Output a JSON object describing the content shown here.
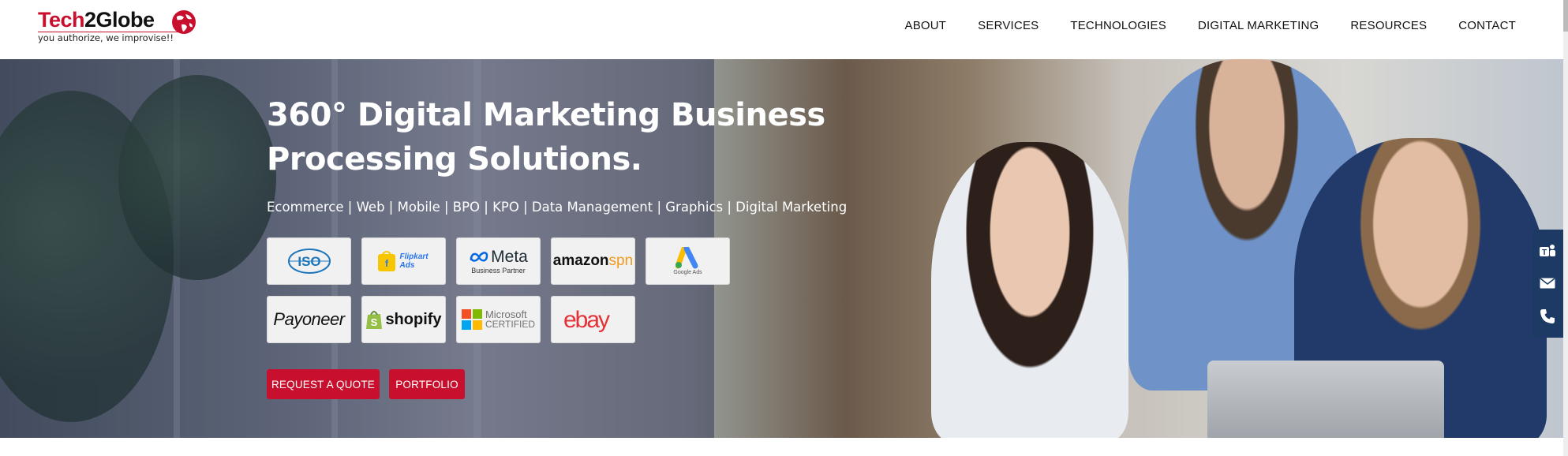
{
  "brand": {
    "name_part1": "Tech",
    "name_part2": "2Globe",
    "tagline": "you authorize, we improvise!!",
    "colors": {
      "primary": "#c8102e",
      "sidebar": "#1c3a64"
    }
  },
  "nav": {
    "items": [
      "ABOUT",
      "SERVICES",
      "TECHNOLOGIES",
      "DIGITAL MARKETING",
      "RESOURCES",
      "CONTACT"
    ]
  },
  "hero": {
    "title_line1": "360° Digital Marketing Business",
    "title_line2": "Processing Solutions.",
    "subtitle": "Ecommerce | Web | Mobile | BPO | KPO | Data Management | Graphics | Digital Marketing",
    "badges": [
      {
        "label": "ISO",
        "icon": "iso-logo"
      },
      {
        "label": "Flipkart Ads",
        "icon": "flipkart-ads-logo"
      },
      {
        "label": "Meta",
        "sub": "Business Partner",
        "icon": "meta-logo"
      },
      {
        "label": "amazon",
        "sub": "spn",
        "icon": "amazon-spn-logo"
      },
      {
        "label": "Google Ads",
        "icon": "google-ads-logo"
      },
      {
        "label": "Payoneer",
        "icon": "payoneer-logo"
      },
      {
        "label": "shopify",
        "icon": "shopify-logo"
      },
      {
        "label": "Microsoft",
        "sub": "CERTIFIED",
        "icon": "microsoft-logo"
      },
      {
        "label": "ebay",
        "icon": "ebay-logo"
      }
    ],
    "buttons": {
      "quote": "REQUEST A QUOTE",
      "portfolio": "PORTFOLIO"
    }
  },
  "side_contact": {
    "icons": [
      "teams-icon",
      "mail-icon",
      "phone-icon"
    ]
  }
}
